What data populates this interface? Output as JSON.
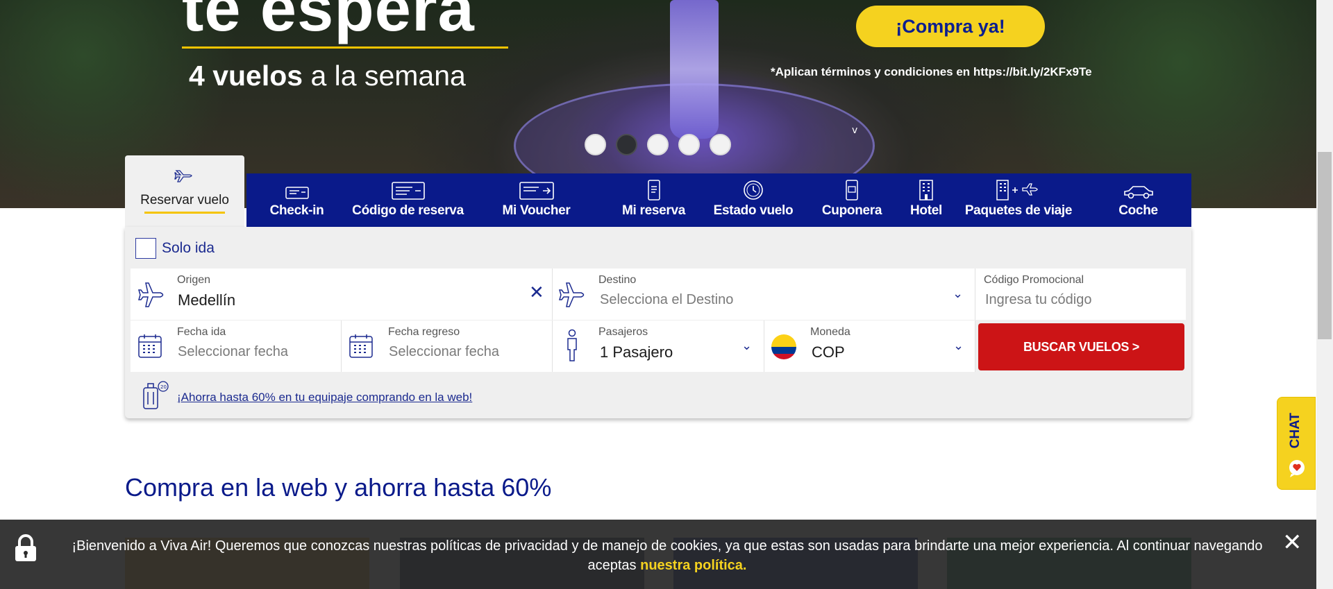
{
  "hero": {
    "title": "te espera",
    "subtitle_bold": "4 vuelos",
    "subtitle_rest": " a la semana",
    "cta": "¡Compra ya!",
    "terms": "*Aplican términos y condiciones en https://bit.ly/2KFx9Te",
    "caret": "v",
    "slides": 5,
    "active_slide": 2
  },
  "tabs": {
    "active": {
      "label": "Reservar vuelo",
      "icon": "plane-icon"
    },
    "items": [
      {
        "label": "Check-in",
        "icon": "boarding-pass-icon"
      },
      {
        "label": "Código de reserva",
        "icon": "ticket-icon"
      },
      {
        "label": "Mi Voucher",
        "icon": "voucher-icon"
      },
      {
        "label": "Mi reserva",
        "icon": "phone-ticket-icon"
      },
      {
        "label": "Estado vuelo",
        "icon": "clock-icon"
      },
      {
        "label": "Cuponera",
        "icon": "coupon-phone-icon"
      },
      {
        "label": "Hotel",
        "icon": "hotel-icon"
      },
      {
        "label": "Paquetes de viaje",
        "icon": "package-icon"
      },
      {
        "label": "Coche",
        "icon": "car-icon"
      }
    ]
  },
  "form": {
    "one_way_label": "Solo ida",
    "origin": {
      "label": "Origen",
      "value": "Medellín"
    },
    "destination": {
      "label": "Destino",
      "placeholder": "Selecciona el Destino"
    },
    "promo": {
      "label": "Código Promocional",
      "placeholder": "Ingresa tu código"
    },
    "depart": {
      "label": "Fecha ida",
      "placeholder": "Seleccionar fecha"
    },
    "return": {
      "label": "Fecha regreso",
      "placeholder": "Seleccionar fecha"
    },
    "passengers": {
      "label": "Pasajeros",
      "value": "1 Pasajero"
    },
    "currency": {
      "label": "Moneda",
      "value": "COP"
    },
    "search_button": "BUSCAR VUELOS >",
    "baggage_link": "¡Ahorra hasta 60% en tu equipaje comprando en la web!"
  },
  "section": {
    "title": "Compra en la web y ahorra hasta 60%"
  },
  "cookie": {
    "text": "¡Bienvenido a Viva Air! Queremos que conozcas nuestras políticas de privacidad y de manejo de cookies, ya que estas son usadas para brindarte una mejor experiencia. Al continuar navegando aceptas ",
    "link": "nuestra política.",
    "close": "✕"
  },
  "chat": {
    "label": "CHAT"
  },
  "colors": {
    "brand_blue": "#0a1a8a",
    "brand_yellow": "#f5d21f",
    "search_red": "#cc1416"
  }
}
